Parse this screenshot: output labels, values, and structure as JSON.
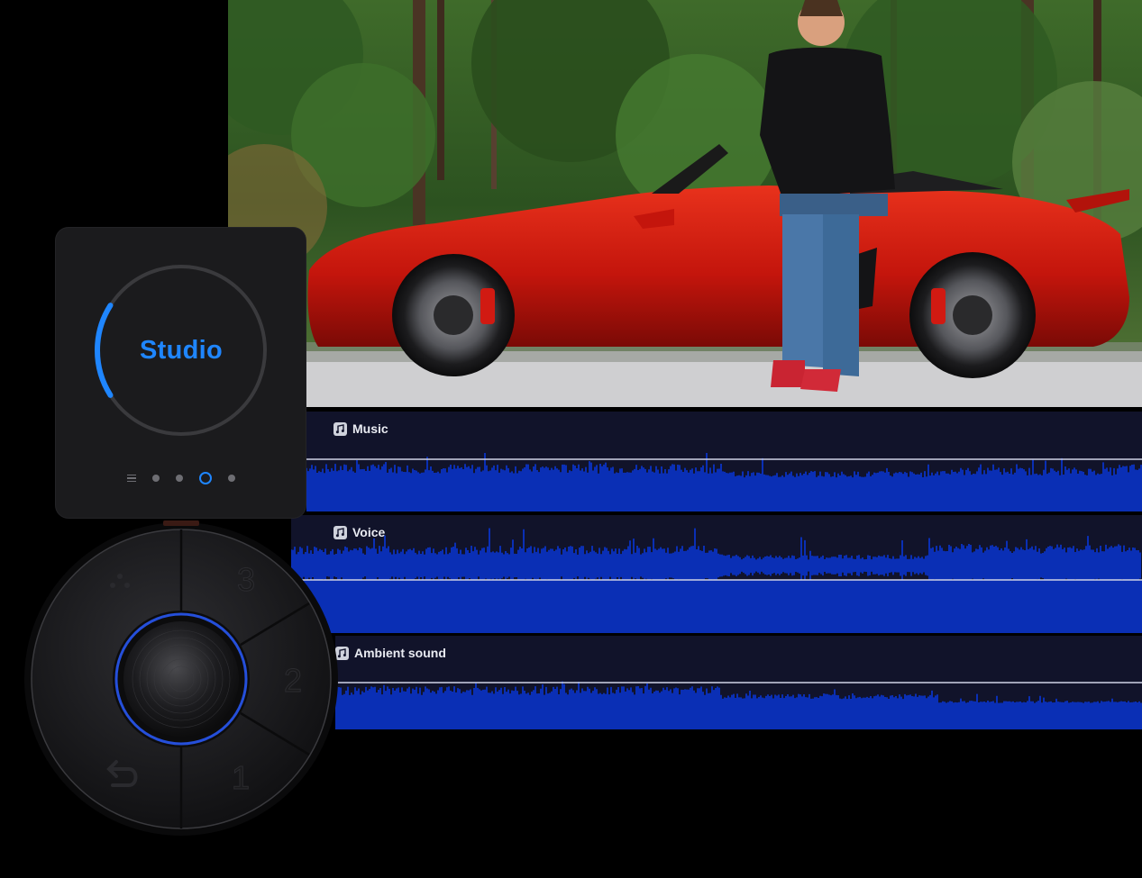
{
  "studio_card": {
    "mode_label": "Studio",
    "ring_progress": 0.18,
    "pager": {
      "pages": 4,
      "active_index": 2
    }
  },
  "tracks": [
    {
      "label": "Music",
      "icon": "music-note-icon"
    },
    {
      "label": "Voice",
      "icon": "music-note-icon"
    },
    {
      "label": "Ambient sound",
      "icon": "music-note-icon"
    }
  ],
  "knob": {
    "buttons": [
      {
        "label": "3",
        "name": "preset-3-button"
      },
      {
        "label": "2",
        "name": "preset-2-button"
      },
      {
        "label": "1",
        "name": "preset-1-button"
      }
    ],
    "back_icon": "back-arrow-icon",
    "more_icon": "dots-icon"
  },
  "colors": {
    "accent": "#1f86ff",
    "waveform": "#0a2fb5",
    "track_bg": "#11132a",
    "card_bg": "#1b1b1d"
  }
}
